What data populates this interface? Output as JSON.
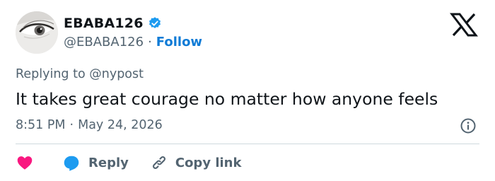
{
  "tweet": {
    "author": {
      "display_name": "EBABA126",
      "handle": "@EBABA126",
      "verified": true,
      "follow_label": "Follow",
      "separator": "·"
    },
    "replying_to": {
      "prefix": "Replying to",
      "mention": "@nypost"
    },
    "text": "It takes great courage no matter how anyone feels",
    "time": "8:51 PM",
    "date": "May 24, 2026",
    "date_separator": "·"
  },
  "actions": {
    "like_icon": "heart-icon",
    "reply_label": "Reply",
    "copy_link_label": "Copy link"
  },
  "colors": {
    "text_primary": "#0f1419",
    "text_secondary": "#536471",
    "accent": "#0f7bd6",
    "verified": "#1d9bf0",
    "like": "#f91880",
    "reply": "#1d9bf0",
    "divider": "#cfd9de"
  },
  "icons": {
    "brand": "x-logo-icon",
    "info": "info-icon",
    "reply": "speech-bubble-icon",
    "copy_link": "link-icon",
    "verified": "verified-badge-icon"
  }
}
